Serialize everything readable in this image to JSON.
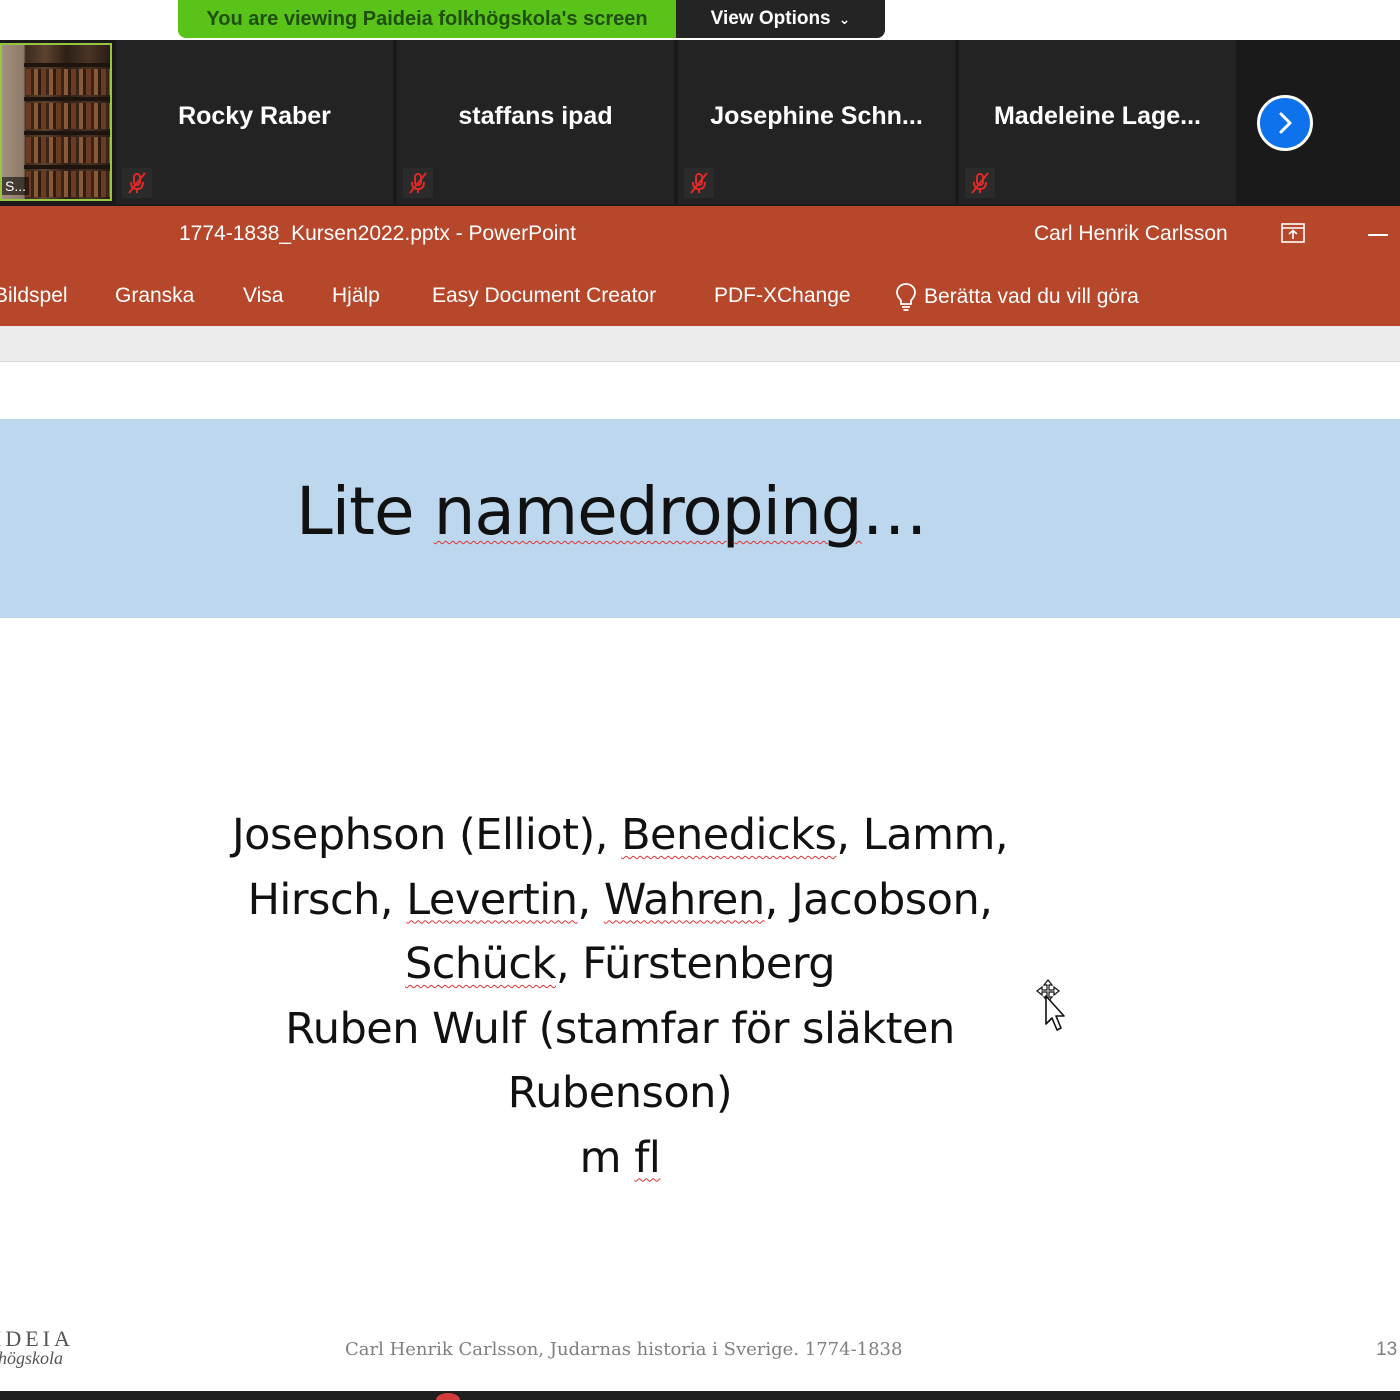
{
  "zoom": {
    "banner": {
      "viewing_text": "You are viewing Paideia folkhögskola's screen",
      "options_label": "View Options",
      "options_chevron": "⌄"
    },
    "video_participant": {
      "name_truncated": "S..."
    },
    "participants": [
      {
        "name": "Rocky Raber",
        "mic_icon": "mic-muted-icon"
      },
      {
        "name": "staffans ipad",
        "mic_icon": "mic-muted-icon"
      },
      {
        "name": "Josephine  Schn...",
        "mic_icon": "mic-muted-icon"
      },
      {
        "name": "Madeleine  Lage...",
        "mic_icon": "mic-muted-icon"
      }
    ],
    "next_icon": "chevron-right-icon",
    "colors": {
      "banner_green": "#5ac31a",
      "next_blue": "#0e72ed",
      "mute_red": "#e02828"
    }
  },
  "powerpoint": {
    "doc_title": "1774-1838_Kursen2022.pptx  -  PowerPoint",
    "user_name": "Carl Henrik Carlsson",
    "tabs": [
      "Bildspel",
      "Granska",
      "Visa",
      "Hjälp",
      "Easy Document Creator",
      "PDF-XChange"
    ],
    "tell_me": "Berätta vad du vill göra",
    "accent_color": "#b7472a"
  },
  "slide": {
    "title_prefix": "Lite ",
    "title_word": "namedroping",
    "title_suffix": "…",
    "body": {
      "l1a": "Josephson (Elliot), ",
      "l1b": "Benedicks",
      "l1c": ", Lamm,",
      "l2a": "Hirsch, ",
      "l2b": "Levertin",
      "l2c": ", ",
      "l2d": "Wahren",
      "l2e": ", Jacobson,",
      "l3a": "Schück",
      "l3b": ", Fürstenberg",
      "l4": "Ruben Wulf (stamfar för släkten",
      "l5": "Rubenson)",
      "l6a": "m ",
      "l6b": "fl"
    },
    "logo_line1": "IDEIA",
    "logo_line2": "högskola",
    "footer": "Carl Henrik Carlsson, Judarnas historia i Sverige. 1774-1838",
    "slide_number": "13",
    "band_color": "#bdd7ee"
  }
}
